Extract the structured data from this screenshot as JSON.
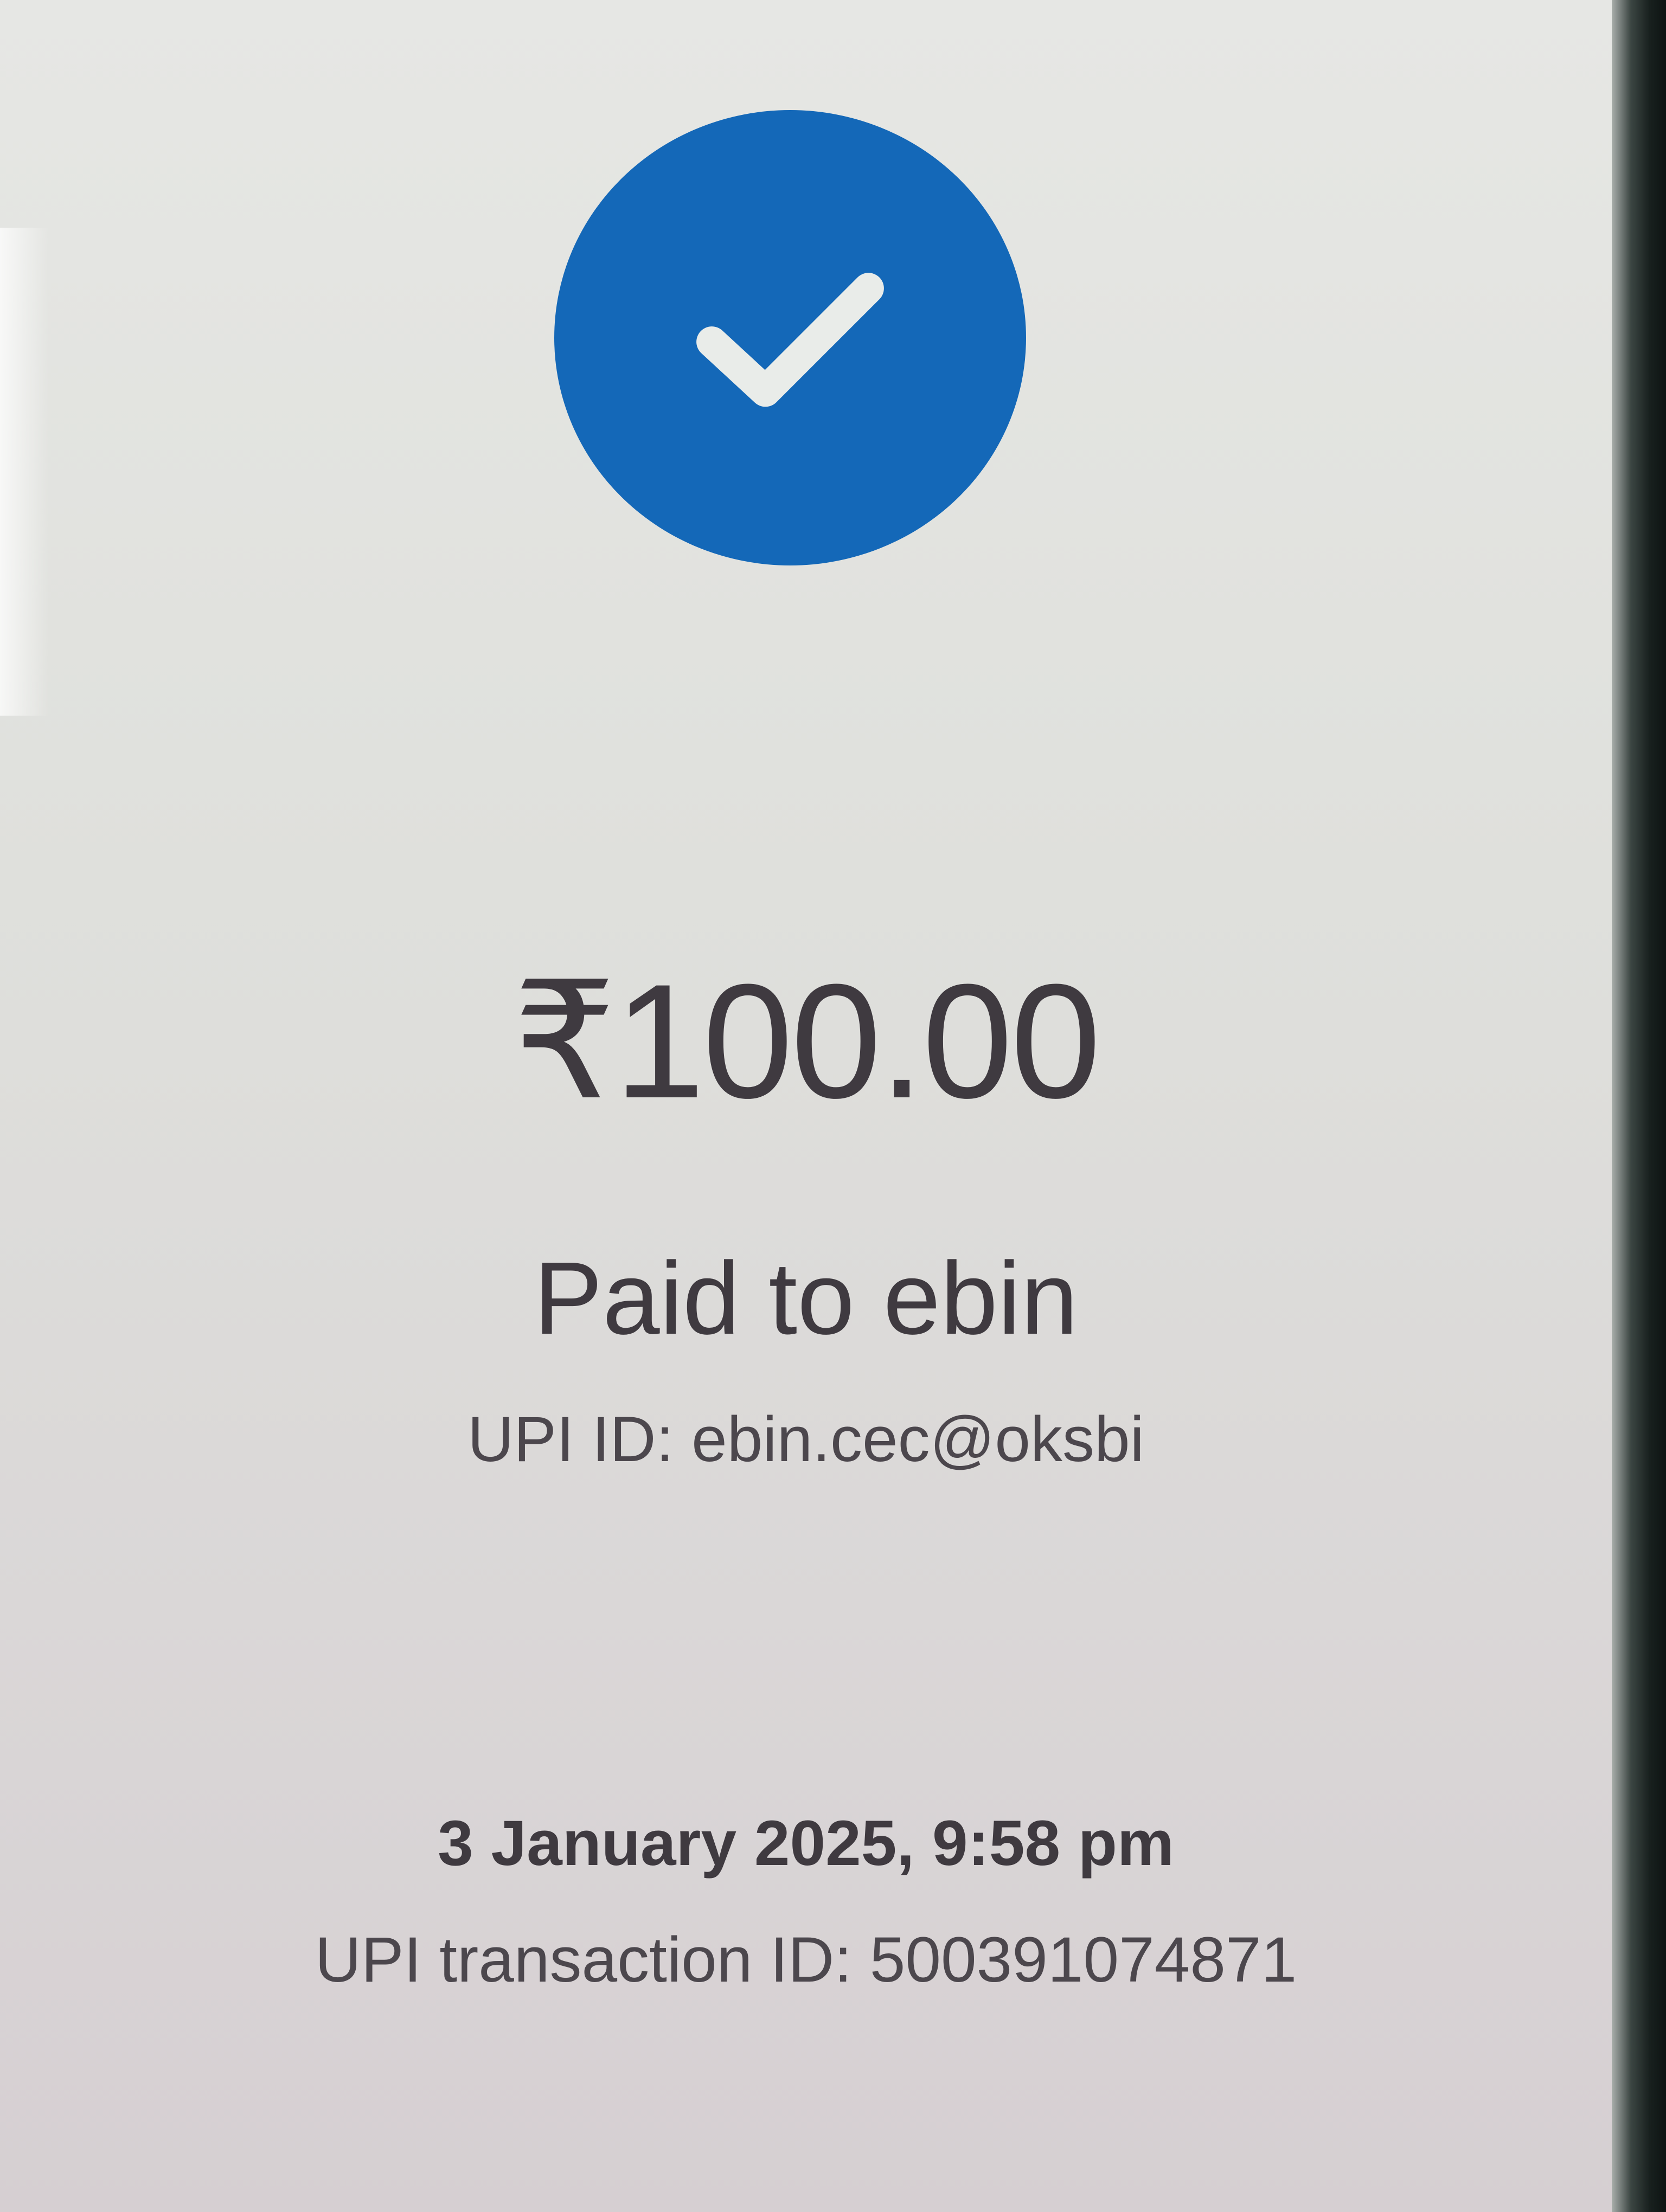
{
  "payment": {
    "status_icon": "checkmark-icon",
    "amount": "₹100.00",
    "paid_to": "Paid to ebin",
    "upi_id": "UPI ID: ebin.cec@oksbi",
    "datetime": "3 January 2025, 9:58 pm",
    "transaction_id": "UPI transaction ID: 500391074871"
  },
  "colors": {
    "accent": "#1468b8",
    "text_primary": "#3f3a40",
    "text_secondary": "#4c474d"
  }
}
